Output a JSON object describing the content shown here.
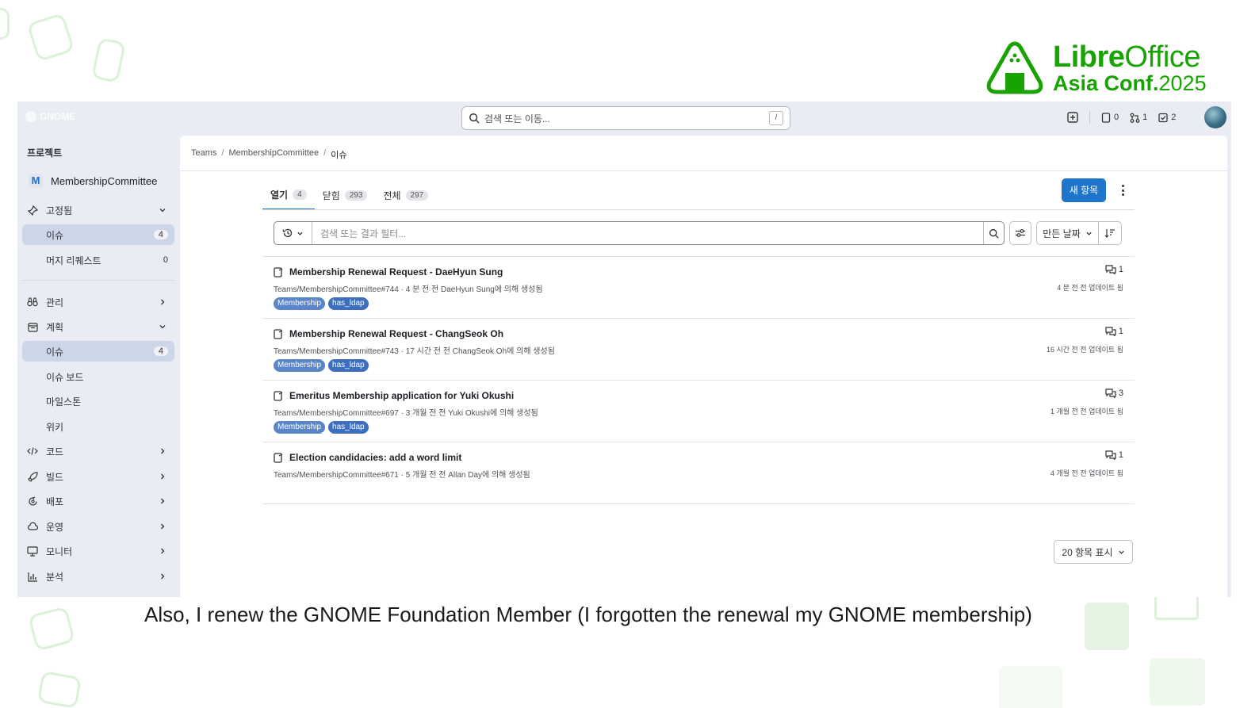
{
  "slide": {
    "logo": {
      "brand_bold": "Libre",
      "brand_light": "Office",
      "line2_bold": "Asia Conf.",
      "line2_year": "2025"
    },
    "caption": "Also, I renew the GNOME Foundation Member (I forgotten the renewal my GNOME membership)",
    "accent_color": "#18a303"
  },
  "topbar": {
    "brand": "GNOME",
    "search_placeholder": "검색 또는 이동...",
    "search_shortcut": "/",
    "issues_count": "0",
    "mr_count": "1",
    "todo_count": "2"
  },
  "sidebar": {
    "heading": "프로젝트",
    "project_initial": "M",
    "project_name": "MembershipCommittee",
    "items": [
      {
        "label": "고정됨",
        "icon": "pin-icon"
      },
      {
        "label": "이슈",
        "count": "4"
      },
      {
        "label": "머지 리퀘스트",
        "count": "0"
      },
      {
        "label": "관리",
        "icon": "binoculars-icon"
      },
      {
        "label": "계획",
        "icon": "calendar-icon"
      },
      {
        "label": "이슈",
        "count": "4"
      },
      {
        "label": "이슈 보드"
      },
      {
        "label": "마일스톤"
      },
      {
        "label": "위키"
      },
      {
        "label": "코드",
        "icon": "code-icon"
      },
      {
        "label": "빌드",
        "icon": "rocket-icon"
      },
      {
        "label": "배포",
        "icon": "deploy-icon"
      },
      {
        "label": "운영",
        "icon": "cloud-icon"
      },
      {
        "label": "모니터",
        "icon": "monitor-icon"
      },
      {
        "label": "분석",
        "icon": "chart-icon"
      }
    ]
  },
  "breadcrumb": [
    "Teams",
    "MembershipCommittee",
    "이슈"
  ],
  "tabs": [
    {
      "label": "열기",
      "count": "4"
    },
    {
      "label": "닫힘",
      "count": "293"
    },
    {
      "label": "전체",
      "count": "297"
    }
  ],
  "new_item_label": "새 항목",
  "filter": {
    "placeholder": "검색 또는 결과 필터...",
    "sort_label": "만든 날짜"
  },
  "issues": [
    {
      "title": "Membership Renewal Request - DaeHyun Sung",
      "meta": "Teams/MembershipCommittee#744 · 4 분 전 전 DaeHyun Sung에 의해 생성됨",
      "labels": [
        "Membership",
        "has_ldap"
      ],
      "comments": "1",
      "updated": "4 분 전 전 업데이트 됨"
    },
    {
      "title": "Membership Renewal Request - ChangSeok Oh",
      "meta": "Teams/MembershipCommittee#743 · 17 시간 전 전 ChangSeok Oh에 의해 생성됨",
      "labels": [
        "Membership",
        "has_ldap"
      ],
      "comments": "1",
      "updated": "16 시간 전 전 업데이트 됨"
    },
    {
      "title": "Emeritus Membership application for Yuki Okushi",
      "meta": "Teams/MembershipCommittee#697 · 3 개월 전 전 Yuki Okushi에 의해 생성됨",
      "labels": [
        "Membership",
        "has_ldap"
      ],
      "comments": "3",
      "updated": "1 개월 전 전 업데이트 됨"
    },
    {
      "title": "Election candidacies: add a word limit",
      "meta": "Teams/MembershipCommittee#671 · 5 개월 전 전 Allan Day에 의해 생성됨",
      "labels": [],
      "comments": "1",
      "updated": "4 개월 전 전 업데이트 됨"
    }
  ],
  "per_page": "20 항목 표시"
}
